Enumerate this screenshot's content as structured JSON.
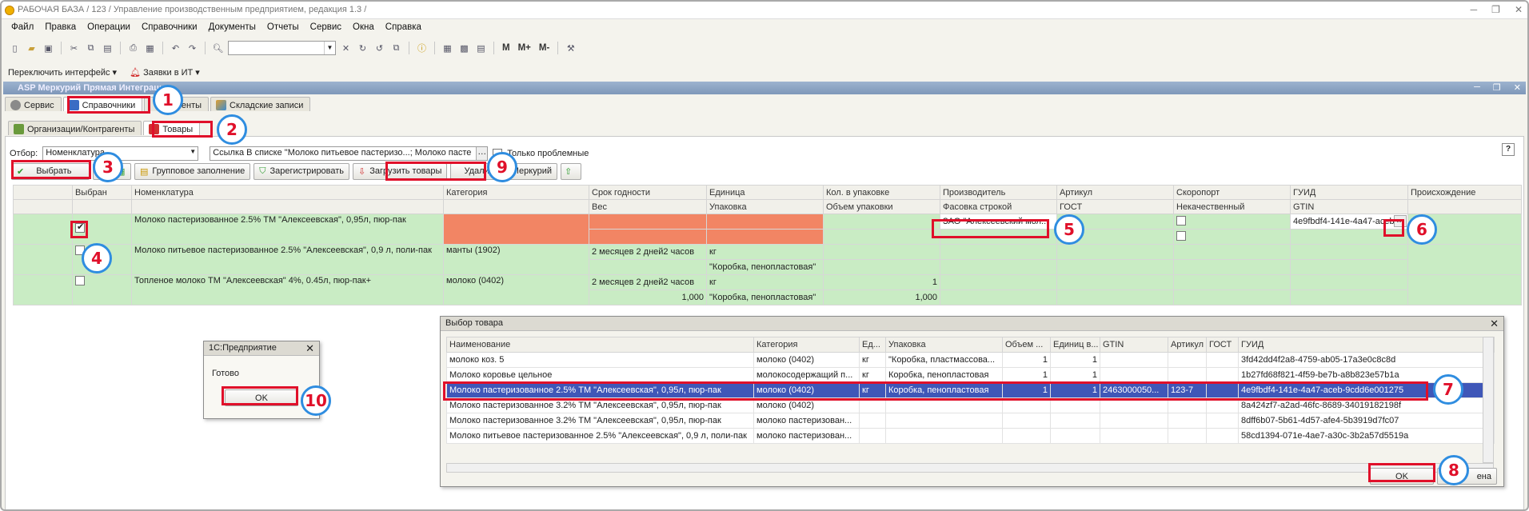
{
  "app": {
    "title": "РАБОЧАЯ БАЗА / 123 /  Управление производственным предприятием, редакция 1.3 /"
  },
  "menu": [
    "Файл",
    "Правка",
    "Операции",
    "Справочники",
    "Документы",
    "Отчеты",
    "Сервис",
    "Окна",
    "Справка"
  ],
  "toolbar2": {
    "switch_ui": "Переключить интерфейс ▾",
    "it_requests": "Заявки в ИТ ▾"
  },
  "toolbar1": {
    "m": "M",
    "m_plus": "M+",
    "m_minus": "M-"
  },
  "subwindow": {
    "title": "ASP Меркурий Прямая Интеграция"
  },
  "tabs_top": [
    {
      "label": "Сервис"
    },
    {
      "label": "Справочники"
    },
    {
      "label": "Документы"
    },
    {
      "label": "Складские записи"
    }
  ],
  "tabs_sub": [
    {
      "label": "Организации/Контрагенты"
    },
    {
      "label": "Товары"
    }
  ],
  "filter": {
    "label": "Отбор:",
    "field": "Номенклатура",
    "value": "Ссылка В списке \"Молоко питьевое пастеризо...; Молоко пасте",
    "only_problem": "Только проблемные",
    "help": "?"
  },
  "buttons": {
    "select": "Выбрать",
    "group_fill": "Групповое заполнение",
    "register": "Зарегистрировать",
    "load": "Загрузить товары",
    "delete": "Удалить из Меркурий"
  },
  "grid": {
    "headers_top": [
      "",
      "Выбран",
      "Номенклатура",
      "Категория",
      "Срок годности",
      "Единица",
      "Кол. в упаковке",
      "Производитель",
      "Артикул",
      "Скоропорт",
      "ГУИД",
      "Происхождение"
    ],
    "headers_bottom": [
      "",
      "",
      "",
      "",
      "Вес",
      "Упаковка",
      "Объем упаковки",
      "Фасовка строкой",
      "ГОСТ",
      "Некачественный",
      "GTIN",
      ""
    ],
    "rows": [
      {
        "name": "Молоко пастеризованное 2.5%  ТМ \"Алексеевская\", 0,95л, пюр-пак",
        "category": "",
        "shelf": "",
        "weight": "",
        "unit": "",
        "pack": "",
        "qty": "",
        "volume": "",
        "producer": "ЗАО \"Алексеевский мол...",
        "guid": "4e9fbdf4-141e-4a47-aceb",
        "guid_btn": "..."
      },
      {
        "name": "Молоко питьевое пастеризованное 2.5% \"Алексеевская\", 0,9 л, поли-пак",
        "category": "манты (1902)",
        "shelf": "2 месяцев 2 дней2 часов",
        "weight": "",
        "unit": "кг",
        "pack": "\"Коробка, пенопластовая\"",
        "qty": "",
        "volume": ""
      },
      {
        "name": "Топленое молоко  ТМ \"Алексеевская\" 4%, 0.45л, пюр-пак+",
        "category": "молоко (0402)",
        "shelf": "2 месяцев 2 дней2 часов",
        "weight": "1,000",
        "unit": "кг",
        "pack": "\"Коробка, пенопластовая\"",
        "qty": "1",
        "volume": "1,000"
      }
    ]
  },
  "dialog": {
    "title": "Выбор товара",
    "close": "✕",
    "headers": [
      "Наименование",
      "Категория",
      "Ед...",
      "Упаковка",
      "Объем ...",
      "Единиц в...",
      "GTIN",
      "Артикул",
      "ГОСТ",
      "ГУИД"
    ],
    "rows": [
      [
        "молоко коз. 5",
        "молоко (0402)",
        "кг",
        "\"Коробка, пластмасcова...",
        "1",
        "1",
        "",
        "",
        "",
        "3fd42dd4f2a8-4759-ab05-17a3e0c8c8d"
      ],
      [
        "Молоко коровье цельное",
        "молокосодержащий п...",
        "кг",
        "Коробка, пенопластовая",
        "1",
        "1",
        "",
        "",
        "",
        "1b27fd68f821-4f59-be7b-a8b823e57b1a"
      ],
      [
        "Молоко пастеризованное 2.5% ТМ \"Алексеевская\", 0,95л, пюр-пак",
        "молоко (0402)",
        "кг",
        "Коробка, пенопластовая",
        "1",
        "1",
        "2463000050...",
        "123-7",
        "",
        "4e9fbdf4-141e-4a47-aceb-9cdd6e001275"
      ],
      [
        "Молоко пастеризованное 3.2% ТМ \"Алексеевская\", 0,95л, пюр-пак",
        "молоко (0402)",
        "",
        "",
        "",
        "",
        "",
        "",
        "",
        "8a424zf7-a2ad-46fc-8689-34019182198f"
      ],
      [
        "Молоко пастеризованное 3.2% ТМ \"Алексеевская\", 0,95л, пюр-пак",
        "молоко пастеризован...",
        "",
        "",
        "",
        "",
        "",
        "",
        "",
        "8dff6b07-5b61-4d57-afe4-5b3919d7fc07"
      ],
      [
        "Молоко питьевое пастеризованное 2.5% \"Алексеевская\", 0,9 л, поли-пак",
        "молоко пастеризован...",
        "",
        "",
        "",
        "",
        "",
        "",
        "",
        "58cd1394-071e-4ae7-a30c-3b2a57d5519a"
      ]
    ],
    "ok": "OK",
    "cancel_partial": "ена"
  },
  "message": {
    "title": "1С:Предприятие",
    "close": "✕",
    "text": "Готово",
    "ok": "OK"
  },
  "callouts": [
    "1",
    "2",
    "3",
    "4",
    "5",
    "6",
    "7",
    "8",
    "9",
    "10"
  ],
  "colors": {
    "accent_red": "#e0102a",
    "callout_blue": "#2f8de0",
    "row_green": "#c9ecc4",
    "selection_blue": "#3f57b8",
    "cell_orange": "#f28564"
  }
}
